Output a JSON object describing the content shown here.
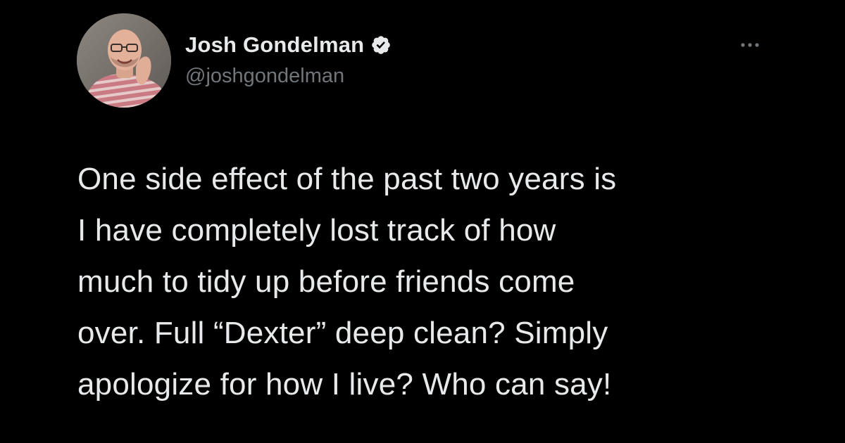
{
  "author": {
    "display_name": "Josh Gondelman",
    "handle": "@joshgondelman",
    "verified": true,
    "verified_icon": "verified-badge-icon",
    "avatar": "profile-photo"
  },
  "tweet": {
    "lines": [
      "One side effect of the past two years is",
      "I have completely lost track of how",
      "much to tidy up before friends come",
      "over. Full “Dexter” deep clean? Simply",
      "apologize for how I live? Who can say!"
    ]
  },
  "actions": {
    "more_icon": "more-options-icon"
  },
  "colors": {
    "background": "#000000",
    "text": "#e7e9ea",
    "secondary_text": "#71767b"
  }
}
